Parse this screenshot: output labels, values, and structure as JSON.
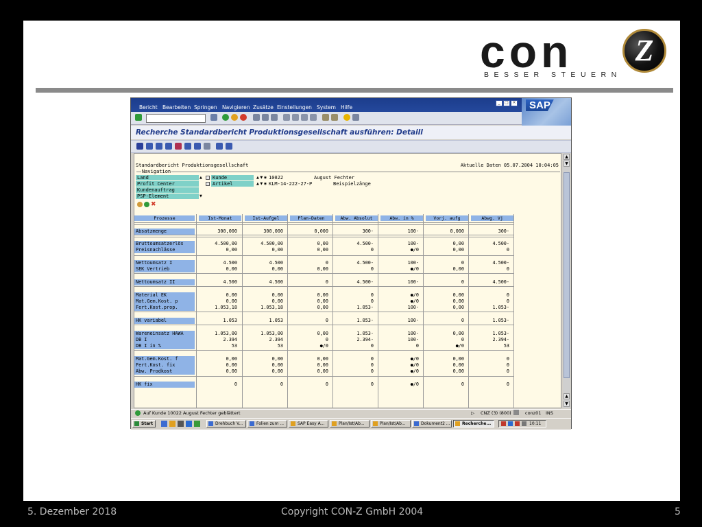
{
  "logo": {
    "word": "con",
    "sub": "BESSER STEUERN",
    "z": "Z"
  },
  "sap": {
    "menu": [
      "Bericht",
      "Bearbeiten",
      "Springen",
      "Navigieren",
      "Zusätze",
      "Einstellungen",
      "System",
      "Hilfe"
    ],
    "title": "Recherche Standardbericht Produktionsgesellschaft ausführen: Detaill",
    "brand": "SAP",
    "report": {
      "name": "Standardbericht Produktionsgesellschaft",
      "date": "Aktuelle Daten 05.07.2004 10:04:05",
      "nav_label": "Navigation",
      "nav_items": [
        "Land",
        "Profit Center",
        "Kundenauftrag",
        "PSP-Element"
      ],
      "chars": [
        {
          "label": "Kunde",
          "value": "10022",
          "text": "August Fechter"
        },
        {
          "label": "Artikel",
          "value": "KLM-14-222-27-P",
          "text": "Beispielzänge"
        }
      ],
      "columns": [
        "Prozesse",
        "Ist-Monat",
        "Ist-Aufgel",
        "Plan-Daten",
        "Abw. Absolut",
        "Abw. in %",
        "Vorj. aufg",
        "Abwg. Vj"
      ],
      "rows": [
        {
          "label": "Absatzmenge",
          "v": [
            "300,000",
            "300,000",
            "0,000",
            "300-",
            "100-",
            "0,000",
            "300-"
          ]
        },
        {
          "label": "Bruttoumsatzerlös",
          "v": [
            "4.500,00",
            "4.500,00",
            "0,00",
            "4.500-",
            "100-",
            "0,00",
            "4.500-"
          ]
        },
        {
          "label": "Preisnachlässe",
          "v": [
            "0,00",
            "0,00",
            "0,00",
            "0",
            "●/0",
            "0,00",
            "0"
          ]
        },
        {
          "label": "Nettoumsatz I",
          "v": [
            "4.500",
            "4.500",
            "0",
            "4.500-",
            "100-",
            "0",
            "4.500-"
          ]
        },
        {
          "label": "SEK Vertrieb",
          "v": [
            "0,00",
            "0,00",
            "0,00",
            "0",
            "●/0",
            "0,00",
            "0"
          ]
        },
        {
          "label": "Nettoumsatz II",
          "v": [
            "4.500",
            "4.500",
            "0",
            "4.500-",
            "100-",
            "0",
            "4.500-"
          ]
        },
        {
          "label": "Material EK",
          "v": [
            "0,00",
            "0,00",
            "0,00",
            "0",
            "●/0",
            "0,00",
            "0"
          ]
        },
        {
          "label": "Mat.Gem.Kost. p",
          "v": [
            "0,00",
            "0,00",
            "0,00",
            "0",
            "●/0",
            "0,00",
            "0"
          ]
        },
        {
          "label": "Fert.Kost.prop.",
          "v": [
            "1.053,18",
            "1.053,18",
            "0,00",
            "1.053-",
            "100-",
            "0,00",
            "1.053-"
          ]
        },
        {
          "label": "HK variabel",
          "v": [
            "1.053",
            "1.053",
            "0",
            "1.053-",
            "100-",
            "0",
            "1.053-"
          ]
        },
        {
          "label": "Wareneinsatz HAWA",
          "v": [
            "1.053,00",
            "1.053,00",
            "0,00",
            "1.053-",
            "100-",
            "0,00",
            "1.053-"
          ]
        },
        {
          "label": "DB I",
          "v": [
            "2.394",
            "2.394",
            "0",
            "2.394-",
            "100-",
            "0",
            "2.394-"
          ]
        },
        {
          "label": "DB I in %",
          "v": [
            "53",
            "53",
            "●/0",
            "0",
            "0",
            "●/0",
            "53"
          ]
        },
        {
          "label": "Mat.Gem.Kost. f",
          "v": [
            "0,00",
            "0,00",
            "0,00",
            "0",
            "●/0",
            "0,00",
            "0"
          ]
        },
        {
          "label": "Fert.Kost. fix",
          "v": [
            "0,00",
            "0,00",
            "0,00",
            "0",
            "●/0",
            "0,00",
            "0"
          ]
        },
        {
          "label": "Abw. Prodkost",
          "v": [
            "0,00",
            "0,00",
            "0,00",
            "0",
            "●/0",
            "0,00",
            "0"
          ]
        },
        {
          "label": "HK fix",
          "v": [
            "0",
            "0",
            "0",
            "0",
            "●/0",
            "0",
            "0"
          ]
        }
      ]
    },
    "status": {
      "message": "Auf Kunde 10022 August Fechter geblättert",
      "system": "CNZ (3) (800)",
      "server": "conz01",
      "mode": "INS"
    },
    "taskbar": {
      "start": "Start",
      "tasks": [
        "Drehbuch V...",
        "Folien zum ...",
        "SAP Easy A...",
        "Plan/Ist/Ab...",
        "Plan/Ist/Ab...",
        "Dokument2 ...",
        "Recherche..."
      ],
      "clock": "10:11"
    }
  },
  "footer": {
    "date": "5. Dezember 2018",
    "copyright": "Copyright CON-Z GmbH 2004",
    "page": "5"
  }
}
